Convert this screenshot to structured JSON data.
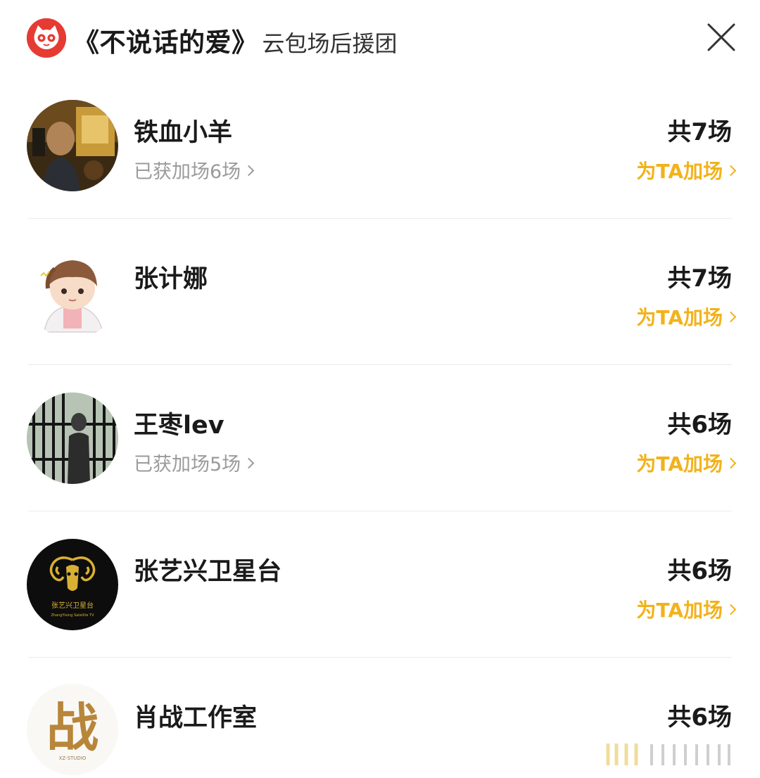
{
  "header": {
    "title": "《不说话的爱》",
    "subtitle": "云包场后援团",
    "logo_icon": "maoyan-cat-logo",
    "close_icon": "close-icon"
  },
  "colors": {
    "accent": "#f2b21a",
    "logo_red": "#e63b33",
    "muted_text": "#9b9b9b",
    "divider": "#ececec"
  },
  "supporters": [
    {
      "name": "铁血小羊",
      "sub_label": "已获加场6场",
      "count": "共7场",
      "action": "为TA加场"
    },
    {
      "name": "张计娜",
      "sub_label": "",
      "count": "共7场",
      "action": "为TA加场"
    },
    {
      "name": "王枣lev",
      "sub_label": "已获加场5场",
      "count": "共6场",
      "action": "为TA加场"
    },
    {
      "name": "张艺兴卫星台",
      "sub_label": "",
      "count": "共6场",
      "action": "为TA加场"
    },
    {
      "name": "肖战工作室",
      "sub_label": "",
      "count": "共6场",
      "action": "为TA加场"
    }
  ],
  "avatar_text": {
    "badge_line1": "张艺兴卫星台",
    "badge_line2": "ZhangYixing Satellite TV",
    "studio_char": "战",
    "studio_label": "XZ-STUDIO"
  }
}
